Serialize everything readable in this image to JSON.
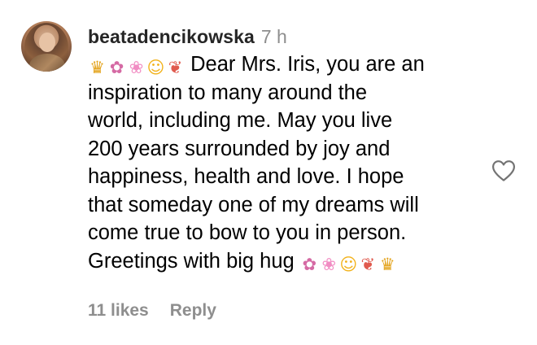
{
  "comment": {
    "username": "beatadencikowska",
    "timestamp": "7 h",
    "lines": [
      "Dear Mrs. Iris, you are an",
      "inspiration to many around the",
      "world, including me. May you live",
      "200 years surrounded by joy and",
      "happiness, health and love. I hope",
      "that someday one of my dreams will",
      "come true to bow to you in person.",
      "Greetings with big hug"
    ],
    "leading_emojis": [
      "crown-emoji",
      "gift-emoji",
      "cherry-blossom-emoji",
      "kiss-emoji",
      "bouquet-emoji"
    ],
    "trailing_emojis": [
      "gift-emoji",
      "cherry-blossom-emoji",
      "kiss-emoji",
      "bouquet-emoji",
      "crown-emoji"
    ],
    "emoji_glyphs": {
      "crown": "♛",
      "gift": "✿",
      "flower": "❀",
      "kiss": "☺",
      "bouquet": "❦"
    },
    "likes_label": "11 likes",
    "reply_label": "Reply",
    "like_icon": "heart-outline-icon"
  },
  "colors": {
    "username": "#262626",
    "muted": "#8e8e8e",
    "text": "#000000",
    "background": "#ffffff"
  }
}
